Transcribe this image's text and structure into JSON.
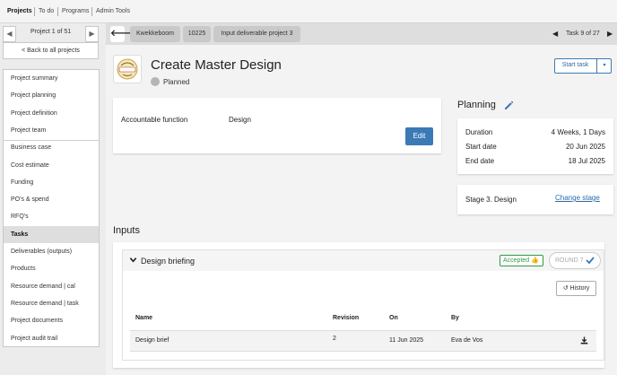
{
  "topnav": {
    "projects": "Projects",
    "todo": "To do",
    "programs": "Programs",
    "admin": "Admin Tools"
  },
  "sidebar": {
    "pager_prev": "◀",
    "pager_label": "Project 1 of 51",
    "pager_next": "▶",
    "back": "< Back to all projects",
    "items": [
      "Project summary",
      "Project planning",
      "Project definition",
      "Project team",
      "Business case",
      "Cost estimate",
      "Funding",
      "PO's & spend",
      "RFQ's",
      "Tasks",
      "Deliverables (outputs)",
      "Products",
      "Resource demand | cal",
      "Resource demand | task",
      "Project documents",
      "Project audit trail"
    ]
  },
  "breadcrumb": {
    "back": "🡐",
    "items": [
      "Kwekkeboom",
      "10225",
      "Input deliverable project 3"
    ],
    "task_counter": "Task 9 of 27",
    "prev": "◀",
    "next": "▶"
  },
  "task": {
    "logo_text": "Kwekke boom",
    "title": "Create Master Design",
    "status": "Planned",
    "start_task": "Start task",
    "caret": "▾",
    "accountable_label": "Accountable function",
    "accountable_value": "Design",
    "edit": "Edit"
  },
  "planning": {
    "title": "Planning",
    "rows": [
      {
        "label": "Duration",
        "value": "4 Weeks, 1 Days"
      },
      {
        "label": "Start date",
        "value": "20 Jun 2025"
      },
      {
        "label": "End date",
        "value": "18 Jul 2025"
      }
    ],
    "stage": "Stage 3. Design",
    "change_stage": "Change stage"
  },
  "inputs": {
    "title": "Inputs",
    "section": "Design briefing",
    "accepted": "Accepted 👍",
    "round": "ROUND 7",
    "history": "↺ History",
    "columns": [
      "Name",
      "Revision",
      "On",
      "By"
    ],
    "rows": [
      {
        "name": "Design brief",
        "revision": "2",
        "on": "11 Jun 2025",
        "by": "Eva de Vos"
      }
    ]
  },
  "colors": {
    "accent": "#3c79b7",
    "accepted": "#2e9a45"
  }
}
